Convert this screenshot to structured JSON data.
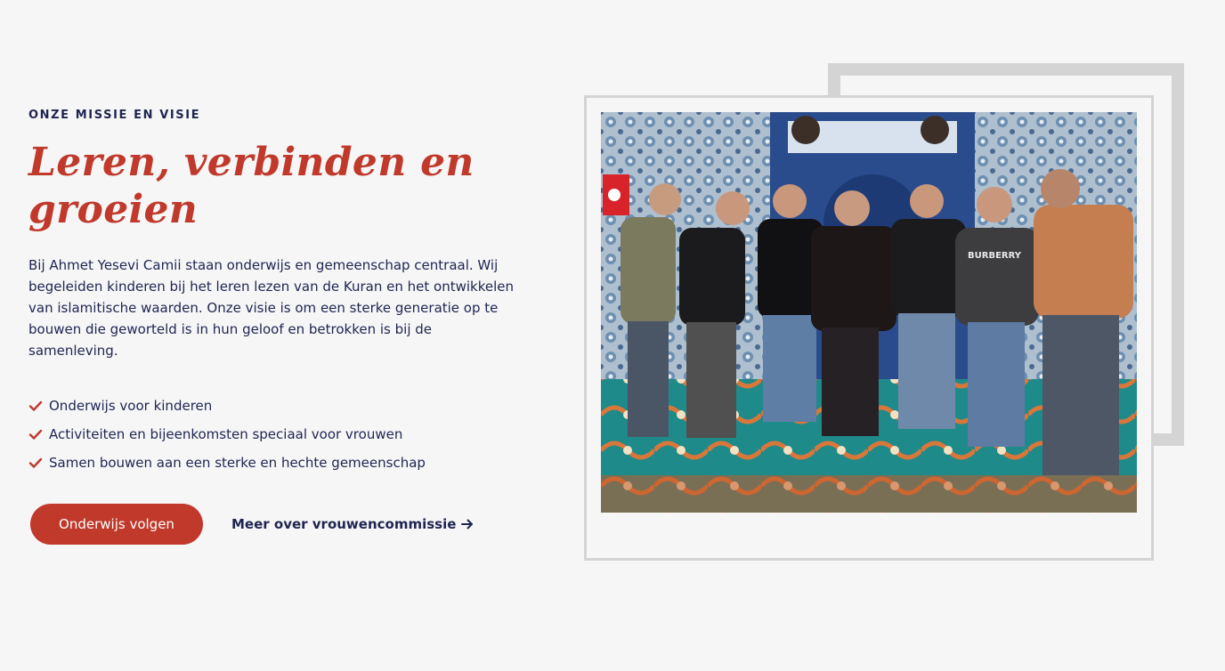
{
  "section": {
    "eyebrow": "ONZE MISSIE EN VISIE",
    "headline": "Leren, verbinden en groeien",
    "body": "Bij Ahmet Yesevi Camii staan onderwijs en gemeenschap centraal. Wij begeleiden kinderen bij het leren lezen van de Kuran en het ontwikkelen van islamitische waarden. Onze visie is om een sterke generatie op te bouwen die geworteld is in hun geloof en betrokken is bij de samenleving.",
    "checklist": [
      {
        "label": "Onderwijs voor kinderen",
        "icon": "check-icon"
      },
      {
        "label": "Activiteiten en bijeenkomsten speciaal voor vrouwen",
        "icon": "check-icon"
      },
      {
        "label": "Samen bouwen aan een sterke en hechte gemeenschap",
        "icon": "check-icon"
      }
    ],
    "primary_button": "Onderwijs volgen",
    "secondary_link": "Meer over vrouwencommissie",
    "secondary_link_icon": "arrow-right-icon"
  },
  "photo": {
    "subject": "group-photo",
    "shirt_text": "BURBERRY"
  },
  "colors": {
    "accent": "#c0392b",
    "navy": "#1f2550",
    "background": "#f6f6f7",
    "frame": "#d4d4d5"
  }
}
